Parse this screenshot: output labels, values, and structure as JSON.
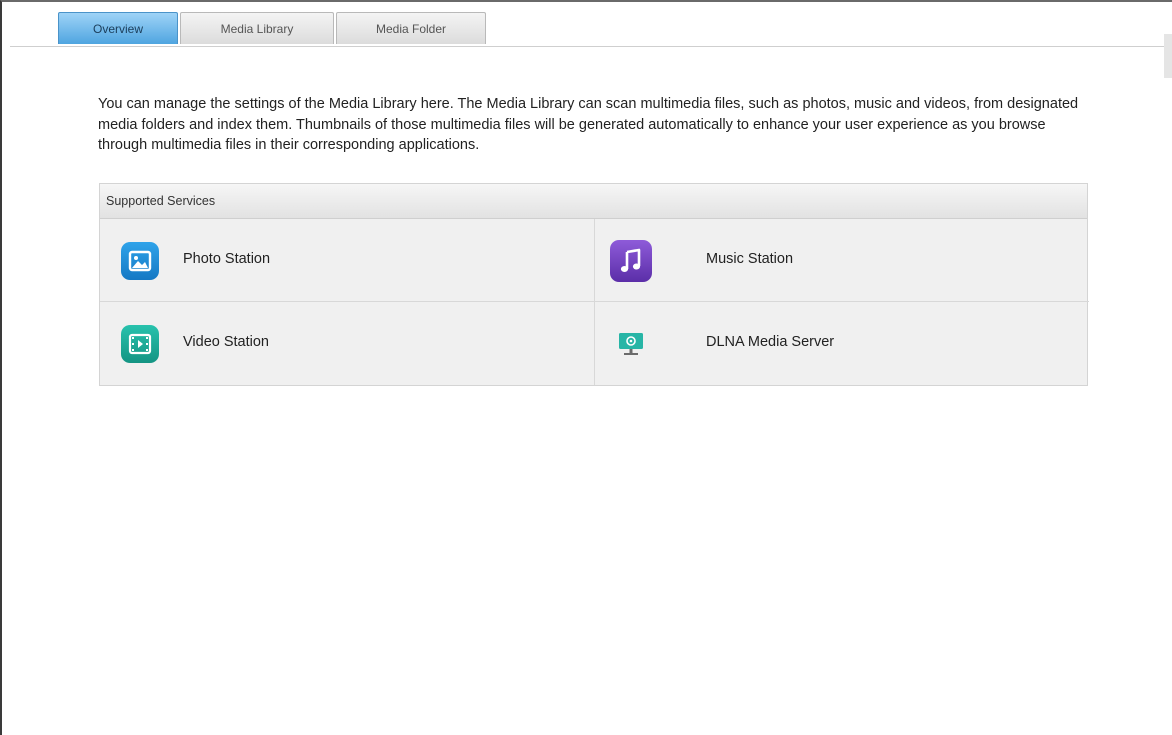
{
  "tabs": [
    {
      "label": "Overview",
      "active": true
    },
    {
      "label": "Media Library",
      "active": false
    },
    {
      "label": "Media Folder",
      "active": false
    }
  ],
  "description": "You can manage the settings of the Media Library here. The Media Library can scan multimedia files, such as photos, music and videos, from designated media folders and index them. Thumbnails of those multimedia files will be generated automatically to enhance your user experience as you browse through multimedia files in their corresponding applications.",
  "supported_services": {
    "header": "Supported Services",
    "items": [
      {
        "label": "Photo Station",
        "icon": "photo-station-icon",
        "color": "#1f8fd6"
      },
      {
        "label": "Music Station",
        "icon": "music-station-icon",
        "color": "#7a45c7"
      },
      {
        "label": "Video Station",
        "icon": "video-station-icon",
        "color": "#1aa99a"
      },
      {
        "label": "DLNA Media Server",
        "icon": "dlna-media-server-icon",
        "color": "#27b5a6"
      }
    ]
  },
  "colors": {
    "active_tab": "#4fa5e0",
    "panel_bg": "#f0f0f0"
  }
}
